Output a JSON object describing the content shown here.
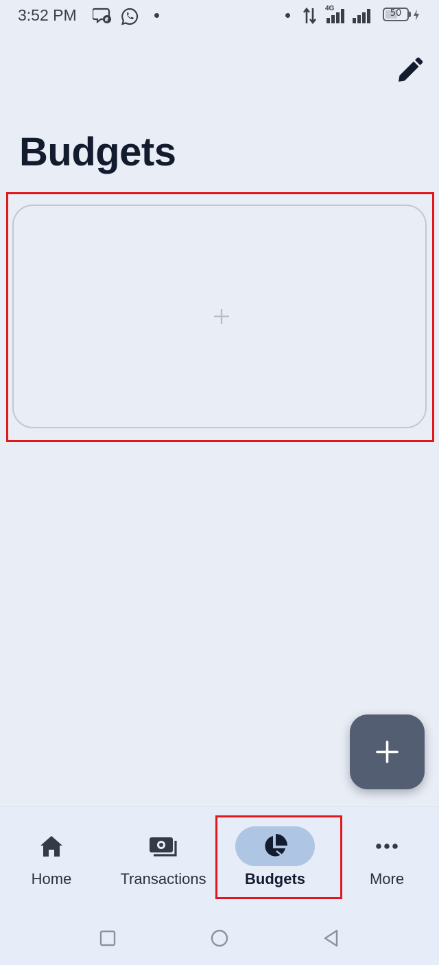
{
  "status_bar": {
    "time": "3:52 PM",
    "network": "4G",
    "battery": "50",
    "icons": [
      "messenger-icon",
      "whatsapp-icon",
      "data-transfer-icon",
      "signal-icon",
      "battery-icon"
    ]
  },
  "header": {
    "title": "Budgets",
    "edit_icon": "pencil-icon"
  },
  "add_card": {
    "icon": "plus-icon"
  },
  "fab": {
    "icon": "plus-icon"
  },
  "bottom_nav": {
    "items": [
      {
        "label": "Home",
        "icon": "home-icon",
        "active": false
      },
      {
        "label": "Transactions",
        "icon": "money-icon",
        "active": false
      },
      {
        "label": "Budgets",
        "icon": "pie-chart-icon",
        "active": true
      },
      {
        "label": "More",
        "icon": "more-icon",
        "active": false
      }
    ]
  },
  "colors": {
    "background": "#e9edf5",
    "title": "#131b2e",
    "fab": "#535e72",
    "active_pill": "#aec6e4",
    "highlight": "#e3171b"
  }
}
